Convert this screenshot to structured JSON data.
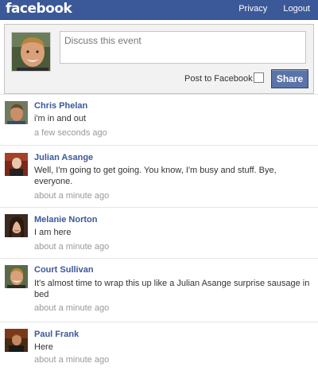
{
  "header": {
    "logo": "facebook",
    "links": [
      "Privacy",
      "Logout"
    ]
  },
  "composer": {
    "placeholder": "Discuss this event",
    "post_to_label": "Post to Facebook",
    "post_to_checked": false,
    "share_label": "Share"
  },
  "posts": [
    {
      "name": "Chris Phelan",
      "text": "i'm in and out",
      "time": "a few seconds ago"
    },
    {
      "name": "Julian Asange",
      "text": "Well, I'm going to get going. You know, I'm busy and stuff. Bye, everyone.",
      "time": "about a minute ago"
    },
    {
      "name": "Melanie Norton",
      "text": "I am here",
      "time": "about a minute ago"
    },
    {
      "name": "Court Sullivan",
      "text": "It's almost time to wrap this up like a Julian Asange surprise sausage in bed",
      "time": "about a minute ago"
    },
    {
      "name": "Paul Frank",
      "text": "Here",
      "time": "about a minute ago"
    }
  ]
}
